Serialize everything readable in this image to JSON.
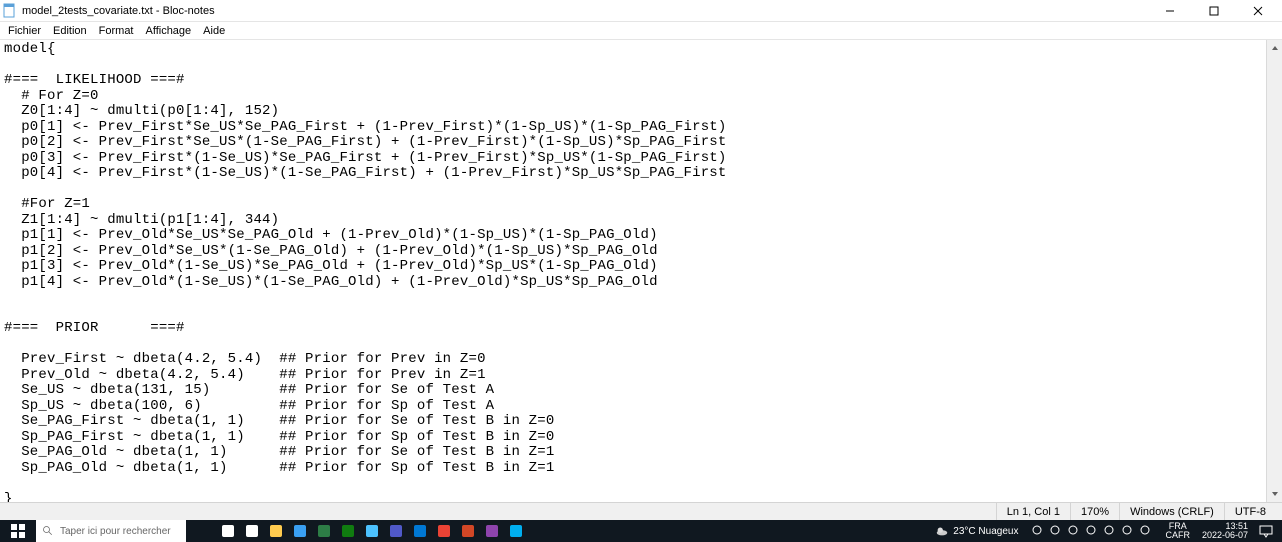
{
  "titlebar": {
    "title": "model_2tests_covariate.txt - Bloc-notes"
  },
  "menu": {
    "items": [
      "Fichier",
      "Edition",
      "Format",
      "Affichage",
      "Aide"
    ]
  },
  "editor": {
    "content": "model{\n\n#===  LIKELIHOOD ===#\n  # For Z=0\n  Z0[1:4] ~ dmulti(p0[1:4], 152)\n  p0[1] <- Prev_First*Se_US*Se_PAG_First + (1-Prev_First)*(1-Sp_US)*(1-Sp_PAG_First)\n  p0[2] <- Prev_First*Se_US*(1-Se_PAG_First) + (1-Prev_First)*(1-Sp_US)*Sp_PAG_First\n  p0[3] <- Prev_First*(1-Se_US)*Se_PAG_First + (1-Prev_First)*Sp_US*(1-Sp_PAG_First)\n  p0[4] <- Prev_First*(1-Se_US)*(1-Se_PAG_First) + (1-Prev_First)*Sp_US*Sp_PAG_First\n\n  #For Z=1\n  Z1[1:4] ~ dmulti(p1[1:4], 344)\n  p1[1] <- Prev_Old*Se_US*Se_PAG_Old + (1-Prev_Old)*(1-Sp_US)*(1-Sp_PAG_Old)\n  p1[2] <- Prev_Old*Se_US*(1-Se_PAG_Old) + (1-Prev_Old)*(1-Sp_US)*Sp_PAG_Old\n  p1[3] <- Prev_Old*(1-Se_US)*Se_PAG_Old + (1-Prev_Old)*Sp_US*(1-Sp_PAG_Old)\n  p1[4] <- Prev_Old*(1-Se_US)*(1-Se_PAG_Old) + (1-Prev_Old)*Sp_US*Sp_PAG_Old\n\n\n#===  PRIOR      ===#\n\n  Prev_First ~ dbeta(4.2, 5.4)  ## Prior for Prev in Z=0\n  Prev_Old ~ dbeta(4.2, 5.4)    ## Prior for Prev in Z=1\n  Se_US ~ dbeta(131, 15)        ## Prior for Se of Test A\n  Sp_US ~ dbeta(100, 6)         ## Prior for Sp of Test A\n  Se_PAG_First ~ dbeta(1, 1)    ## Prior for Se of Test B in Z=0\n  Sp_PAG_First ~ dbeta(1, 1)    ## Prior for Sp of Test B in Z=0\n  Se_PAG_Old ~ dbeta(1, 1)      ## Prior for Se of Test B in Z=1\n  Sp_PAG_Old ~ dbeta(1, 1)      ## Prior for Sp of Test B in Z=1\n\n}"
  },
  "statusbar": {
    "pos": "Ln 1, Col 1",
    "zoom": "170%",
    "eol": "Windows (CRLF)",
    "enc": "UTF-8"
  },
  "taskbar": {
    "search_placeholder": "Taper ici pour rechercher",
    "weather": "23°C  Nuageux",
    "lang_top": "FRA",
    "lang_bot": "CAFR",
    "time": "13:51",
    "date": "2022-06-07"
  },
  "tray_icons": [
    "cloud-icon",
    "up-icon",
    "onedrive-icon",
    "headset-icon",
    "battery-icon",
    "wifi-icon",
    "vol-icon"
  ],
  "task_icons": [
    "cortana-icon",
    "taskview-icon",
    "explorer-icon",
    "store-icon",
    "app1-icon",
    "xbox-icon",
    "edge-icon",
    "teams-icon",
    "outlook-icon",
    "chrome-icon",
    "ppt-icon",
    "app2-icon",
    "skype-icon"
  ]
}
